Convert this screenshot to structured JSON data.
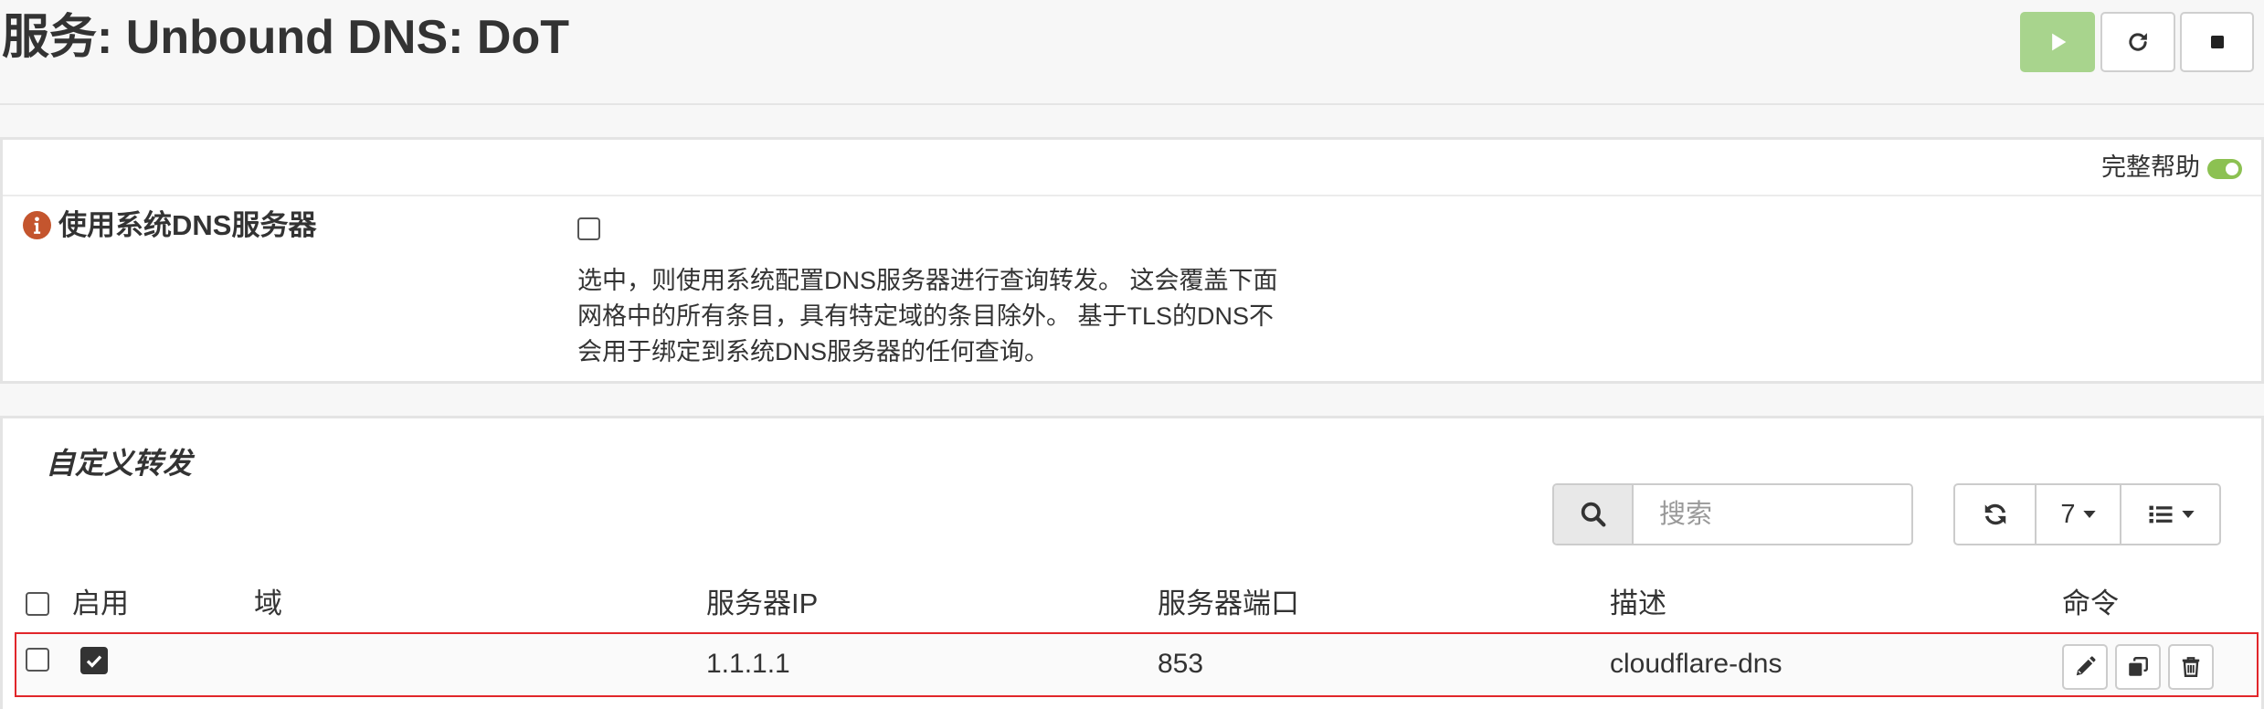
{
  "page": {
    "title": "服务: Unbound DNS: DoT"
  },
  "service_controls": {
    "start": {
      "icon": "play-icon",
      "color": "#a8d48d"
    },
    "restart": {
      "icon": "reload-icon"
    },
    "stop": {
      "icon": "stop-icon"
    }
  },
  "general": {
    "full_help": {
      "label": "完整帮助",
      "enabled": true,
      "color": "#8cc152"
    },
    "use_system_dns": {
      "icon": "info-icon",
      "icon_color": "#c4552e",
      "label": "使用系统DNS服务器",
      "checked": false,
      "help_lines": [
        "选中，则使用系统配置DNS服务器进行查询转发。 这会覆盖下面",
        "网格中的所有条目，具有特定域的条目除外。 基于TLS的DNS不",
        "会用于绑定到系统DNS服务器的任何查询。"
      ]
    }
  },
  "forwarding": {
    "title": "自定义转发",
    "search": {
      "icon": "search-icon",
      "placeholder": "搜索",
      "value": ""
    },
    "toolbar": {
      "refresh_icon": "refresh-icon",
      "page_size": "7",
      "columns_icon": "list-icon"
    },
    "select_all_checked": false,
    "columns": {
      "enabled": "启用",
      "domain": "域",
      "server_ip": "服务器IP",
      "server_port": "服务器端口",
      "description": "描述",
      "commands": "命令"
    },
    "rows": [
      {
        "selected": false,
        "enabled": true,
        "domain": "",
        "server_ip": "1.1.1.1",
        "server_port": "853",
        "description": "cloudflare-dns",
        "commands": [
          "edit-icon",
          "copy-icon",
          "delete-icon"
        ],
        "highlight_color": "#e1262a"
      }
    ]
  }
}
